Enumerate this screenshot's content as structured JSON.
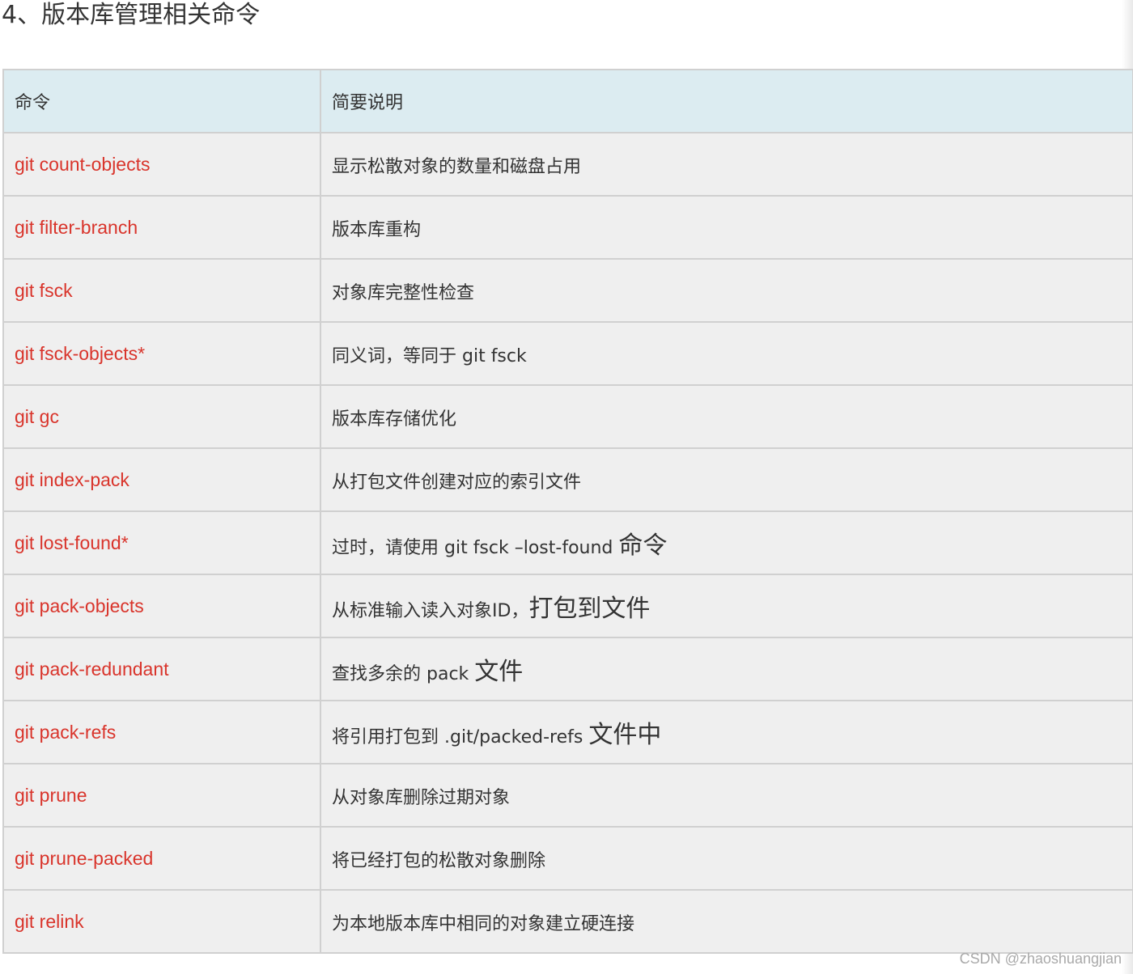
{
  "section_title": "4、版本库管理相关命令",
  "table": {
    "headers": [
      "命令",
      "简要说明"
    ],
    "rows": [
      {
        "command": "git count-objects",
        "description": "显示松散对象的数量和磁盘占用",
        "description_tail": ""
      },
      {
        "command": "git filter-branch",
        "description": "版本库重构",
        "description_tail": ""
      },
      {
        "command": "git fsck",
        "description": "对象库完整性检查",
        "description_tail": ""
      },
      {
        "command": "git fsck-objects*",
        "description": "同义词，等同于 git fsck",
        "description_tail": ""
      },
      {
        "command": "git gc",
        "description": "版本库存储优化",
        "description_tail": ""
      },
      {
        "command": "git index-pack",
        "description": "从打包文件创建对应的索引文件",
        "description_tail": ""
      },
      {
        "command": "git lost-found*",
        "description": "过时，请使用 git fsck –lost-found ",
        "description_tail": "命令"
      },
      {
        "command": "git pack-objects",
        "description": "从标准输入读入对象ID，",
        "description_tail": "打包到文件"
      },
      {
        "command": "git pack-redundant",
        "description": "查找多余的 pack ",
        "description_tail": "文件"
      },
      {
        "command": "git pack-refs",
        "description": "将引用打包到 .git/packed-refs ",
        "description_tail": "文件中"
      },
      {
        "command": "git prune",
        "description": "从对象库删除过期对象",
        "description_tail": ""
      },
      {
        "command": "git prune-packed",
        "description": "将已经打包的松散对象删除",
        "description_tail": ""
      },
      {
        "command": "git relink",
        "description": "为本地版本库中相同的对象建立硬连接",
        "description_tail": ""
      }
    ]
  },
  "watermark": "CSDN @zhaoshuangjian",
  "colors": {
    "command_text": "#d9342b",
    "header_background": "#dcecf1",
    "row_background": "#efefef",
    "border": "#d0d0d0"
  }
}
